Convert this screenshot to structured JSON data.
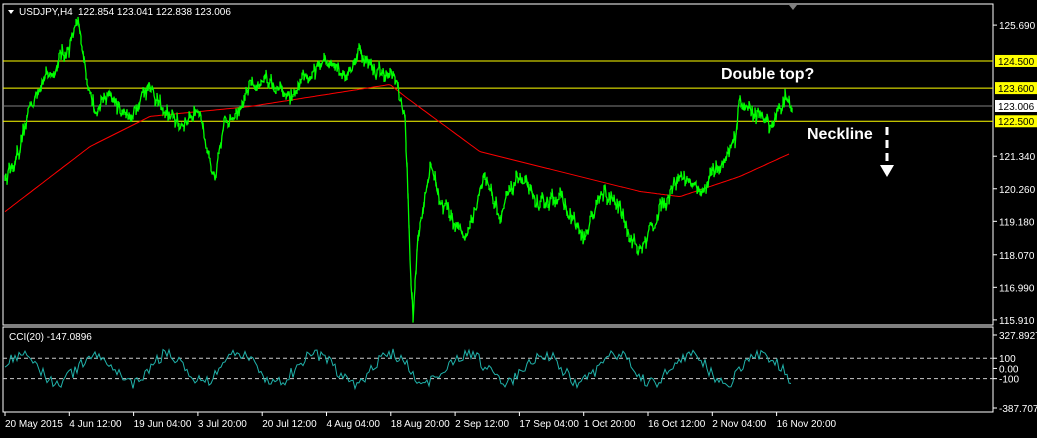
{
  "header": {
    "symbol": "USDJPY,H4",
    "ohlc": "122.854 123.041 122.838 123.006"
  },
  "chart_data": {
    "type": "line",
    "title": "USDJPY,H4",
    "price_axis": {
      "ticks": [
        "125.690",
        "121.340",
        "120.260",
        "119.180",
        "118.070",
        "116.990",
        "115.910"
      ],
      "range": [
        115.74,
        126.39
      ]
    },
    "levels": [
      {
        "label": "124.500",
        "value": 124.5,
        "color": "#ffff00"
      },
      {
        "label": "123.600",
        "value": 123.6,
        "color": "#ffff00"
      },
      {
        "label": "123.006",
        "value": 123.006,
        "color": "#808080",
        "current": true
      },
      {
        "label": "122.500",
        "value": 122.5,
        "color": "#ffff00"
      }
    ],
    "time_axis": [
      "20 May 2015",
      "4 Jun 12:00",
      "19 Jun 04:00",
      "3 Jul 20:00",
      "20 Jul 12:00",
      "4 Aug 04:00",
      "18 Aug 20:00",
      "2 Sep 12:00",
      "17 Sep 04:00",
      "1 Oct 20:00",
      "16 Oct 12:00",
      "2 Nov 04:00",
      "16 Nov 20:00"
    ],
    "bars": 790,
    "series": [
      {
        "name": "USDJPY price",
        "color": "#00ff00",
        "keypoints": [
          [
            0,
            120.66
          ],
          [
            15,
            121.32
          ],
          [
            25,
            122.98
          ],
          [
            35,
            123.81
          ],
          [
            45,
            123.98
          ],
          [
            60,
            124.81
          ],
          [
            73,
            125.57
          ],
          [
            80,
            124.48
          ],
          [
            90,
            122.66
          ],
          [
            105,
            123.32
          ],
          [
            125,
            122.66
          ],
          [
            145,
            123.81
          ],
          [
            160,
            122.66
          ],
          [
            175,
            122.33
          ],
          [
            195,
            122.99
          ],
          [
            210,
            120.33
          ],
          [
            220,
            122.33
          ],
          [
            235,
            123.32
          ],
          [
            260,
            123.98
          ],
          [
            285,
            123.15
          ],
          [
            305,
            123.98
          ],
          [
            330,
            124.64
          ],
          [
            340,
            123.98
          ],
          [
            355,
            124.81
          ],
          [
            370,
            124.15
          ],
          [
            390,
            123.98
          ],
          [
            400,
            122.66
          ],
          [
            405,
            118.02
          ],
          [
            408,
            115.93
          ],
          [
            413,
            118.68
          ],
          [
            425,
            121.0
          ],
          [
            440,
            119.67
          ],
          [
            460,
            118.68
          ],
          [
            480,
            120.67
          ],
          [
            495,
            119.34
          ],
          [
            515,
            120.67
          ],
          [
            535,
            119.67
          ],
          [
            555,
            120.0
          ],
          [
            580,
            118.51
          ],
          [
            595,
            120.0
          ],
          [
            615,
            119.67
          ],
          [
            635,
            118.02
          ],
          [
            655,
            119.67
          ],
          [
            675,
            120.83
          ],
          [
            695,
            120.17
          ],
          [
            715,
            121.0
          ],
          [
            730,
            121.66
          ],
          [
            735,
            123.15
          ],
          [
            755,
            122.66
          ],
          [
            765,
            122.33
          ],
          [
            780,
            123.32
          ],
          [
            787,
            123.0
          ]
        ]
      },
      {
        "name": "Moving Average",
        "color": "#ff0000",
        "keypoints": [
          [
            0,
            119.5
          ],
          [
            85,
            121.66
          ],
          [
            145,
            122.66
          ],
          [
            245,
            122.99
          ],
          [
            385,
            123.72
          ],
          [
            400,
            123.32
          ],
          [
            475,
            121.49
          ],
          [
            555,
            120.83
          ],
          [
            635,
            120.17
          ],
          [
            675,
            120.0
          ],
          [
            735,
            120.67
          ],
          [
            785,
            121.43
          ]
        ]
      }
    ],
    "indicator": {
      "label": "CCI(20) -147.0896",
      "value": -147.0896,
      "ticks": [
        "327.8927",
        "100",
        "0.00",
        "-100",
        "-387.707"
      ],
      "range": [
        -387.707,
        327.8927
      ],
      "levels": [
        100,
        -100
      ],
      "color": "#20b2aa"
    },
    "annotations": [
      {
        "text": "Double top?"
      },
      {
        "text": "Neckline"
      }
    ]
  }
}
